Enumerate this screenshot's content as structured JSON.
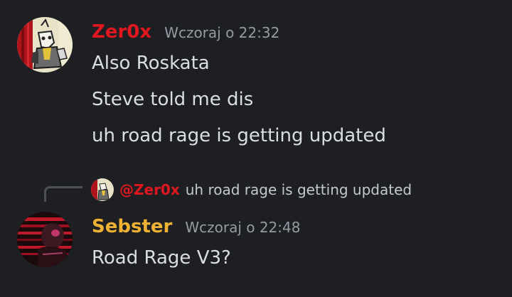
{
  "colors": {
    "background": "#1e1f22",
    "zer0x_name": "#e0171f",
    "sebster_name": "#f0b232",
    "message_text": "#dbdee1",
    "timestamp": "#949ba4"
  },
  "messages": [
    {
      "author": "Zer0x",
      "timestamp": "Wczoraj o 22:32",
      "avatar_icon": "cartoon-character-avatar-icon",
      "lines": [
        "Also Roskata",
        "Steve told me dis",
        "uh road rage is getting updated"
      ]
    },
    {
      "author": "Sebster",
      "timestamp": "Wczoraj o 22:48",
      "avatar_icon": "red-dark-figure-avatar-icon",
      "reply": {
        "author": "@Zer0x",
        "text": "uh road rage is getting updated"
      },
      "lines": [
        "Road Rage V3?"
      ]
    }
  ]
}
